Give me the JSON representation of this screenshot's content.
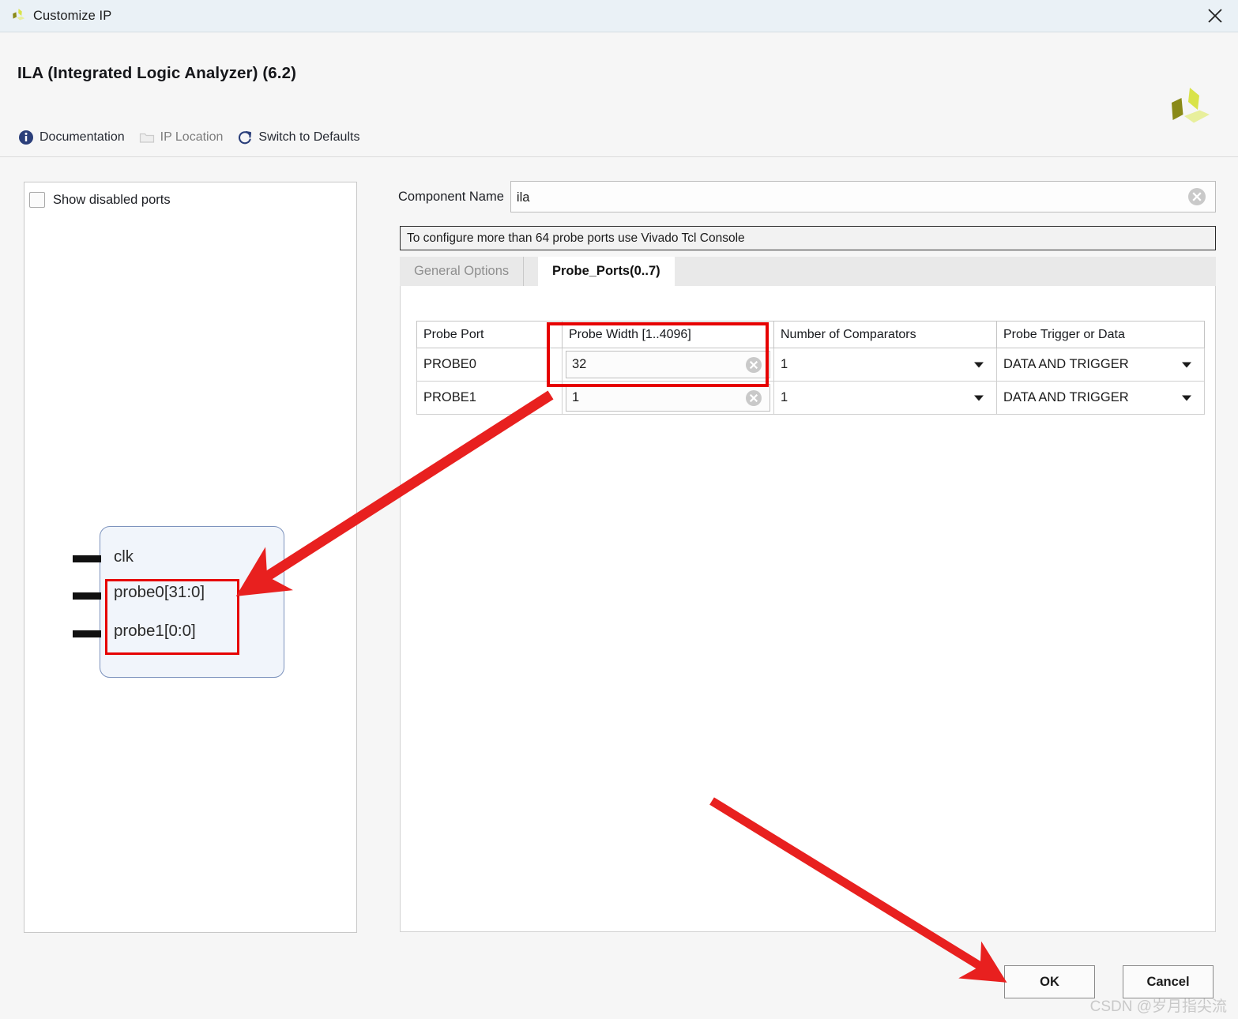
{
  "window": {
    "title": "Customize IP",
    "close_label": "✕",
    "logo_name": "xilinx-logo"
  },
  "header": {
    "ip_title": "ILA (Integrated Logic Analyzer) (6.2)",
    "toolbar": [
      {
        "label": "Documentation",
        "icon": "info-icon",
        "disabled": false
      },
      {
        "label": "IP Location",
        "icon": "folder-icon",
        "disabled": true
      },
      {
        "label": "Switch to Defaults",
        "icon": "refresh-icon",
        "disabled": false
      }
    ]
  },
  "left_panel": {
    "show_disabled_ports": {
      "label": "Show disabled ports",
      "checked": false
    },
    "ip_block": {
      "ports": [
        {
          "label": "clk"
        },
        {
          "label": "probe0[31:0]"
        },
        {
          "label": "probe1[0:0]"
        }
      ]
    }
  },
  "right_panel": {
    "component_name": {
      "label": "Component Name",
      "value": "ila",
      "placeholder": ""
    },
    "message": "To configure more than 64 probe ports use Vivado Tcl Console",
    "tabs": [
      {
        "label": "General Options",
        "active": false
      },
      {
        "label": "Probe_Ports(0..7)",
        "active": true
      }
    ],
    "table": {
      "columns": [
        "Probe Port",
        "Probe Width [1..4096]",
        "Number of Comparators",
        "Probe Trigger or Data"
      ],
      "rows": [
        {
          "port": "PROBE0",
          "width": "32",
          "comparators": "1",
          "trigger_or_data": "DATA AND TRIGGER"
        },
        {
          "port": "PROBE1",
          "width": "1",
          "comparators": "1",
          "trigger_or_data": "DATA AND TRIGGER"
        }
      ]
    }
  },
  "footer": {
    "ok_label": "OK",
    "cancel_label": "Cancel"
  },
  "watermark": "CSDN @岁月指尖流",
  "colors": {
    "titlebar_bg": "#eaf1f6",
    "panel_bg": "#f6f6f6",
    "annotation_red": "#e60000",
    "ip_block_fill": "#f1f5fb",
    "ip_block_border": "#7d93bd",
    "xilinx_yellow": "#d7df36"
  }
}
